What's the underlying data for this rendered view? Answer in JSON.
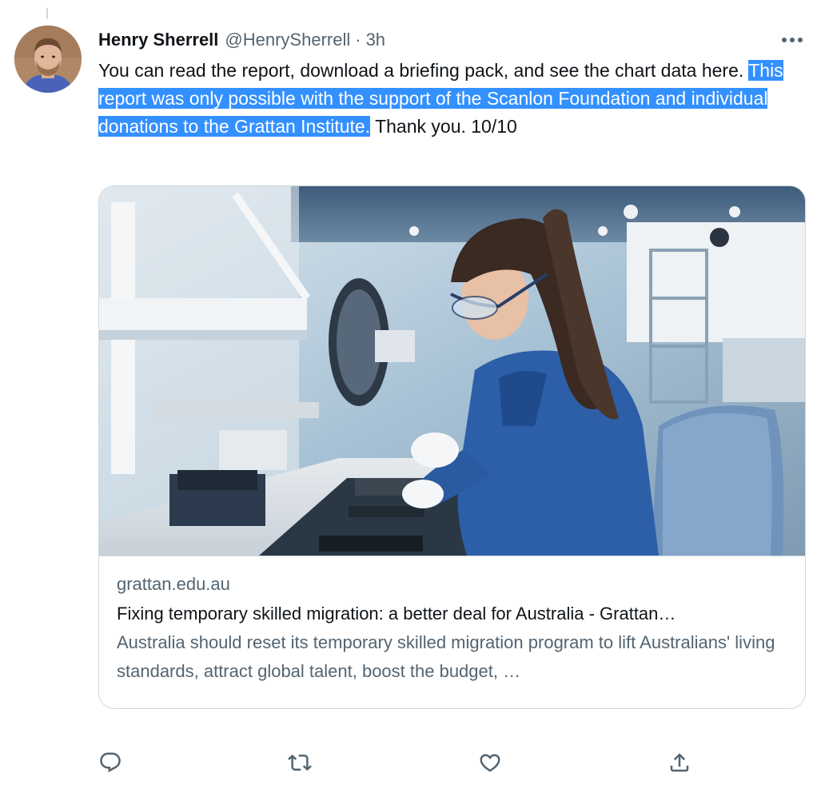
{
  "tweet": {
    "author_name": "Henry Sherrell",
    "handle": "@HenrySherrell",
    "separator": "·",
    "time": "3h",
    "text_part1": "You can read the report, download a briefing pack, and see the chart data here. ",
    "text_highlighted": "This report was only possible with the support of the Scanlon Foundation and individual donations to the Grattan Institute.",
    "text_part2": " Thank you. 10/10",
    "highlight_color": "#3390ff"
  },
  "card": {
    "image_icon": "factory-technician-photo",
    "domain": "grattan.edu.au",
    "title": "Fixing temporary skilled migration: a better deal for Australia - Grattan…",
    "description": "Australia should reset its temporary skilled migration program to lift Australians' living standards, attract global talent, boost the budget, …"
  },
  "actions": {
    "reply_icon": "reply-icon",
    "retweet_icon": "retweet-icon",
    "like_icon": "heart-icon",
    "share_icon": "share-icon"
  },
  "colors": {
    "text_primary": "#0f1419",
    "text_secondary": "#536471",
    "border": "#cfd9de",
    "accent": "#1d9bf0"
  }
}
